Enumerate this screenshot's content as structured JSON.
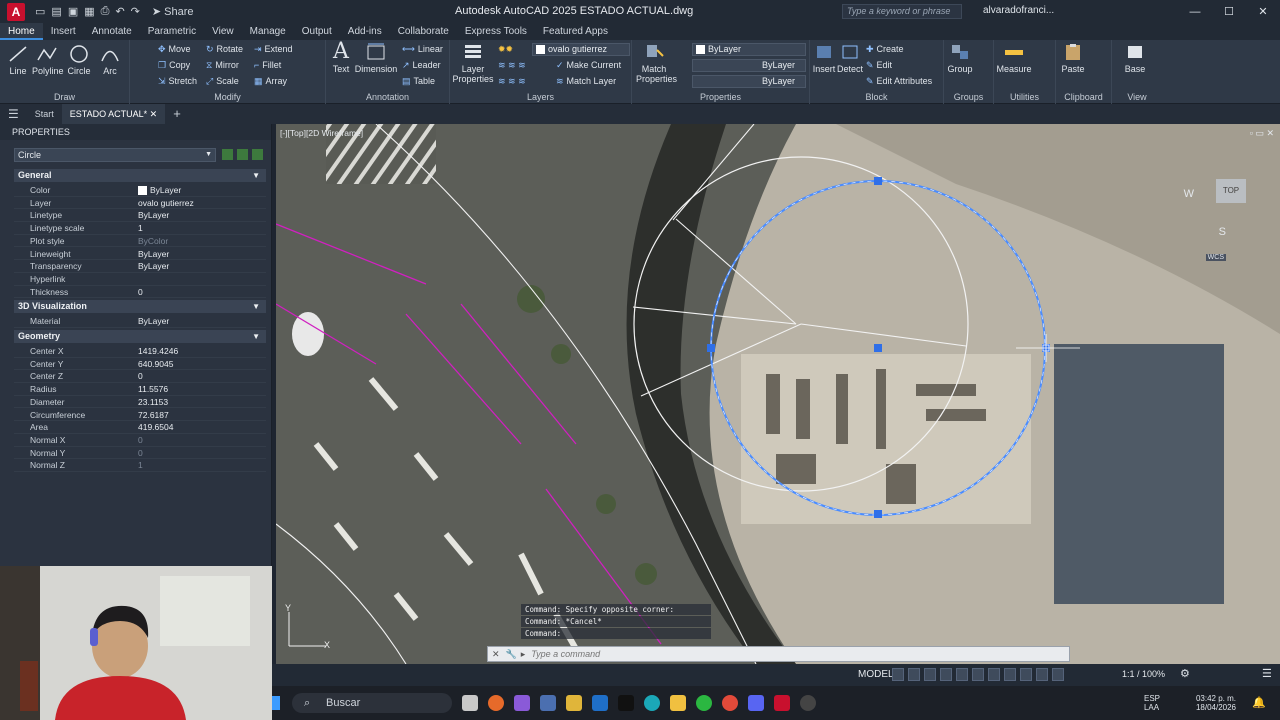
{
  "title_bar": {
    "app_letter": "A",
    "share_label": "Share",
    "title": "Autodesk AutoCAD 2025   ESTADO ACTUAL.dwg",
    "search_placeholder": "Type a keyword or phrase",
    "user": "alvaradofranci..."
  },
  "ribbon_tabs": [
    "Home",
    "Insert",
    "Annotate",
    "Parametric",
    "View",
    "Manage",
    "Output",
    "Add-ins",
    "Collaborate",
    "Express Tools",
    "Featured Apps"
  ],
  "ribbon": {
    "draw": {
      "label": "Draw",
      "line": "Line",
      "polyline": "Polyline",
      "circle": "Circle",
      "arc": "Arc"
    },
    "modify": {
      "label": "Modify",
      "move": "Move",
      "rotate": "Rotate",
      "extend": "Extend",
      "copy": "Copy",
      "mirror": "Mirror",
      "fillet": "Fillet",
      "stretch": "Stretch",
      "scale": "Scale",
      "array": "Array"
    },
    "annotation": {
      "label": "Annotation",
      "text": "Text",
      "dimension": "Dimension",
      "linear": "Linear",
      "leader": "Leader",
      "table": "Table"
    },
    "layers": {
      "label": "Layers",
      "layer_properties": "Layer Properties",
      "current_layer": "ovalo gutierrez",
      "make_current": "Make Current",
      "match_layer": "Match Layer"
    },
    "properties": {
      "label": "Properties",
      "match_properties": "Match Properties",
      "color": "ByLayer",
      "linetype": "ByLayer",
      "lineweight": "ByLayer"
    },
    "block": {
      "label": "Block",
      "insert": "Insert",
      "detect": "Detect",
      "create": "Create",
      "edit": "Edit",
      "edit_attributes": "Edit Attributes"
    },
    "groups": {
      "label": "Groups",
      "group": "Group"
    },
    "utilities": {
      "label": "Utilities",
      "measure": "Measure"
    },
    "clipboard": {
      "label": "Clipboard",
      "paste": "Paste"
    },
    "view": {
      "label": "View",
      "base": "Base"
    }
  },
  "file_tabs": {
    "start": "Start",
    "active": "ESTADO ACTUAL*"
  },
  "properties_panel": {
    "title": "PROPERTIES",
    "object_type": "Circle",
    "general_label": "General",
    "general": [
      {
        "k": "Color",
        "v": "ByLayer"
      },
      {
        "k": "Layer",
        "v": "ovalo gutierrez"
      },
      {
        "k": "Linetype",
        "v": "ByLayer"
      },
      {
        "k": "Linetype scale",
        "v": "1"
      },
      {
        "k": "Plot style",
        "v": "ByColor"
      },
      {
        "k": "Lineweight",
        "v": "ByLayer"
      },
      {
        "k": "Transparency",
        "v": "ByLayer"
      },
      {
        "k": "Hyperlink",
        "v": ""
      },
      {
        "k": "Thickness",
        "v": "0"
      }
    ],
    "viz_label": "3D Visualization",
    "viz": [
      {
        "k": "Material",
        "v": "ByLayer"
      }
    ],
    "geometry_label": "Geometry",
    "geometry": [
      {
        "k": "Center X",
        "v": "1419.4246"
      },
      {
        "k": "Center Y",
        "v": "640.9045"
      },
      {
        "k": "Center Z",
        "v": "0"
      },
      {
        "k": "Radius",
        "v": "11.5576"
      },
      {
        "k": "Diameter",
        "v": "23.1153"
      },
      {
        "k": "Circumference",
        "v": "72.6187"
      },
      {
        "k": "Area",
        "v": "419.6504"
      },
      {
        "k": "Normal X",
        "v": "0"
      },
      {
        "k": "Normal Y",
        "v": "0"
      },
      {
        "k": "Normal Z",
        "v": "1"
      }
    ]
  },
  "viewport": {
    "label": "[-][Top][2D Wireframe]",
    "viewcube_label": "TOP",
    "compass": {
      "w": "W",
      "s": "S",
      "wcs": "WCS"
    }
  },
  "command": {
    "history": [
      "Command: Specify opposite corner:",
      "Command: *Cancel*",
      "Command:"
    ],
    "placeholder": "Type a command"
  },
  "status_bar": {
    "model": "MODEL",
    "scale": "1:1 / 100%"
  },
  "taskbar": {
    "search": "Buscar",
    "lang1": "ESP",
    "lang2": "LAA",
    "time": "03:42 p. m.",
    "date": "18/04/2026"
  }
}
